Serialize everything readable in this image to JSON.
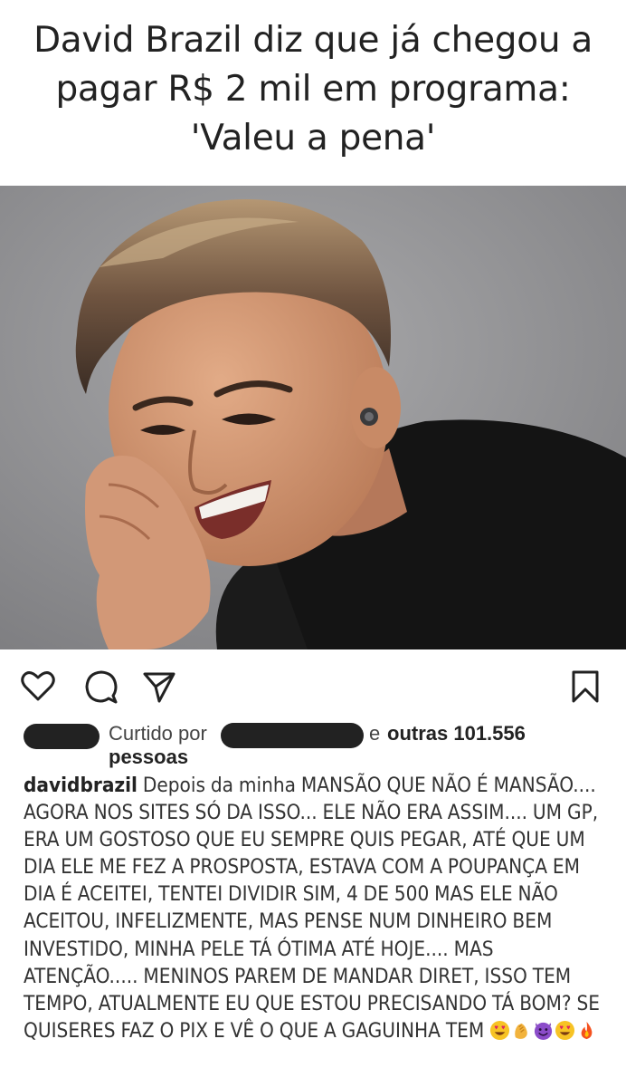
{
  "headline": {
    "line1": "David Brazil diz que já chegou a",
    "line2": "pagar R$ 2 mil em programa:",
    "line3": "'Valeu a pena'"
  },
  "actions": {
    "like_icon": "heart-icon",
    "comment_icon": "comment-icon",
    "share_icon": "send-icon",
    "save_icon": "bookmark-icon"
  },
  "likes": {
    "prefix": "Curtido por",
    "connector": "e",
    "others": "outras 101.556",
    "suffix": "pessoas"
  },
  "caption": {
    "username": "davidbrazil",
    "text": "Depois da minha MANSÃO QUE NÃO É MANSÃO.... AGORA NOS SITES SÓ DA ISSO... ELE NÃO ERA ASSIM.... UM GP, ERA UM GOSTOSO QUE EU SEMPRE QUIS PEGAR, ATÉ QUE UM DIA ELE ME FEZ A PROSPOSTA, ESTAVA COM A POUPANÇA EM DIA É ACEITEI, TENTEI DIVIDIR SIM, 4 DE 500 MAS ELE NÃO ACEITOU, INFELIZMENTE, MAS PENSE NUM DINHEIRO BEM INVESTIDO, MINHA PELE TÁ ÓTIMA ATÉ HOJE.... MAS ATENÇÃO..... MENINOS PAREM DE MANDAR DIRET, ISSO TEM TEMPO, ATUALMENTE EU QUE ESTOU PRECISANDO TÁ BOM? SE QUISERES FAZ O PIX E VÊ O QUE A GAGUINHA TEM",
    "emojis": [
      "heart-eyes-emoji",
      "clapping-hands-emoji",
      "smiling-devil-emoji",
      "heart-eyes-emoji",
      "fire-emoji"
    ]
  },
  "colors": {
    "text": "#222222",
    "photo_background": "#8f8f91",
    "redaction": "#222222"
  }
}
